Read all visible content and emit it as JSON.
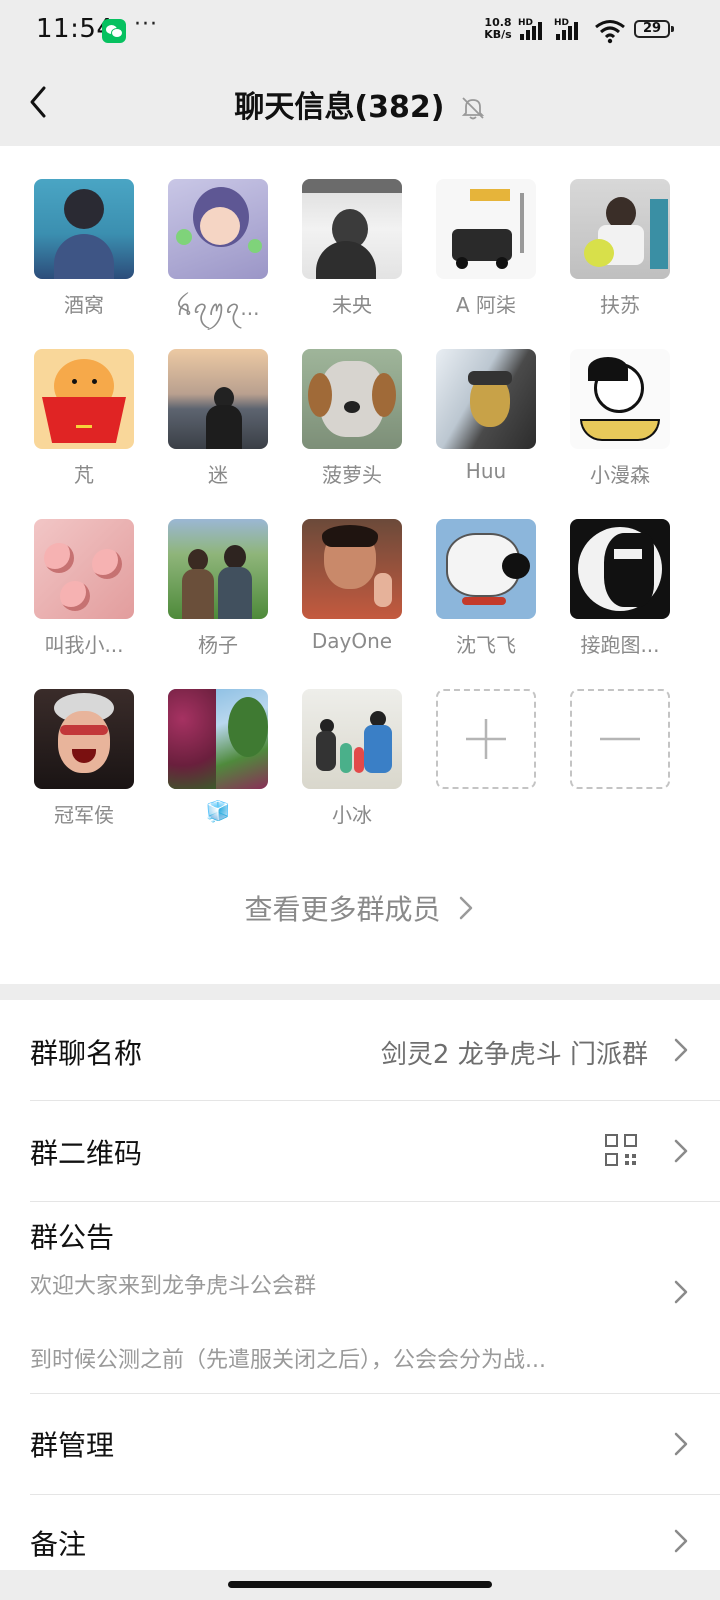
{
  "status_bar": {
    "time": "11:54",
    "dots": "···",
    "speed_value": "10.8",
    "speed_unit": "KB/s",
    "hd": "HD",
    "battery": "29"
  },
  "nav": {
    "title": "聊天信息(382)"
  },
  "members": [
    {
      "name": "酒窝"
    },
    {
      "name": "ꫝꪖꪑꪖ..."
    },
    {
      "name": "未央"
    },
    {
      "name": "A 阿柒"
    },
    {
      "name": "扶苏"
    },
    {
      "name": "芃"
    },
    {
      "name": "迷"
    },
    {
      "name": "菠萝头"
    },
    {
      "name": "Huu"
    },
    {
      "name": "小漫森"
    },
    {
      "name": "叫我小..."
    },
    {
      "name": "杨子"
    },
    {
      "name": "DayOne"
    },
    {
      "name": "沈飞飞"
    },
    {
      "name": "接跑图..."
    },
    {
      "name": "冠军侯"
    },
    {
      "name": "🧊"
    },
    {
      "name": "小冰"
    }
  ],
  "see_more": "查看更多群成员",
  "settings": {
    "group_name_label": "群聊名称",
    "group_name_value": "剑灵2  龙争虎斗 门派群",
    "qr_label": "群二维码",
    "notice_label": "群公告",
    "notice_line1": "欢迎大家来到龙争虎斗公会群",
    "notice_line2": "到时候公测之前（先遣服关闭之后），公会会分为战...",
    "manage_label": "群管理",
    "remark_label": "备注"
  }
}
